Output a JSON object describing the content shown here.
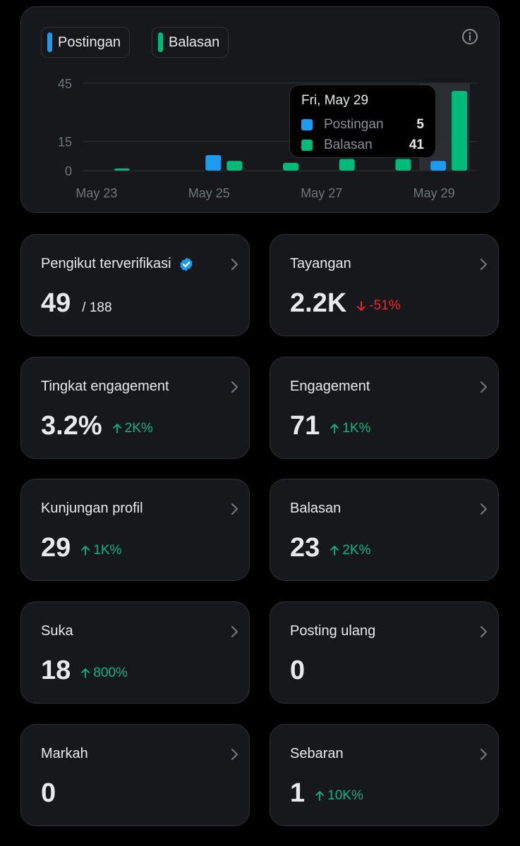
{
  "legend": {
    "items": [
      {
        "label": "Postingan",
        "color": "#1d9bf0"
      },
      {
        "label": "Balasan",
        "color": "#00ba7c"
      }
    ]
  },
  "chart_data": {
    "type": "bar",
    "categories": [
      "May 23",
      "May 24",
      "May 25",
      "May 26",
      "May 27",
      "May 28",
      "May 29"
    ],
    "xticks": [
      "May 23",
      "May 25",
      "May 27",
      "May 29"
    ],
    "yticks": [
      "45",
      "15",
      "0"
    ],
    "ylim": [
      0,
      45
    ],
    "series": [
      {
        "name": "Postingan",
        "color": "#1d9bf0",
        "values": [
          0,
          0,
          8,
          0,
          0,
          0,
          5
        ]
      },
      {
        "name": "Balasan",
        "color": "#00ba7c",
        "values": [
          1,
          0,
          5,
          4,
          6,
          6,
          41
        ]
      }
    ],
    "highlight_index": 6
  },
  "tooltip": {
    "date": "Fri, May 29",
    "rows": [
      {
        "label": "Postingan",
        "value": "5",
        "color": "#1d9bf0"
      },
      {
        "label": "Balasan",
        "value": "41",
        "color": "#00ba7c"
      }
    ]
  },
  "cards": [
    {
      "title": "Pengikut terverifikasi",
      "value": "49",
      "sub": "/ 188",
      "verified": true
    },
    {
      "title": "Tayangan",
      "value": "2.2K",
      "delta": "-51%",
      "dir": "down"
    },
    {
      "title": "Tingkat engagement",
      "value": "3.2%",
      "delta": "2K%",
      "dir": "up"
    },
    {
      "title": "Engagement",
      "value": "71",
      "delta": "1K%",
      "dir": "up"
    },
    {
      "title": "Kunjungan profil",
      "value": "29",
      "delta": "1K%",
      "dir": "up"
    },
    {
      "title": "Balasan",
      "value": "23",
      "delta": "2K%",
      "dir": "up"
    },
    {
      "title": "Suka",
      "value": "18",
      "delta": "800%",
      "dir": "up"
    },
    {
      "title": "Posting ulang",
      "value": "0"
    },
    {
      "title": "Markah",
      "value": "0"
    },
    {
      "title": "Sebaran",
      "value": "1",
      "delta": "10K%",
      "dir": "up"
    }
  ],
  "colors": {
    "up": "#00ba7c",
    "down": "#f4212e",
    "verified": "#1d9bf0"
  }
}
